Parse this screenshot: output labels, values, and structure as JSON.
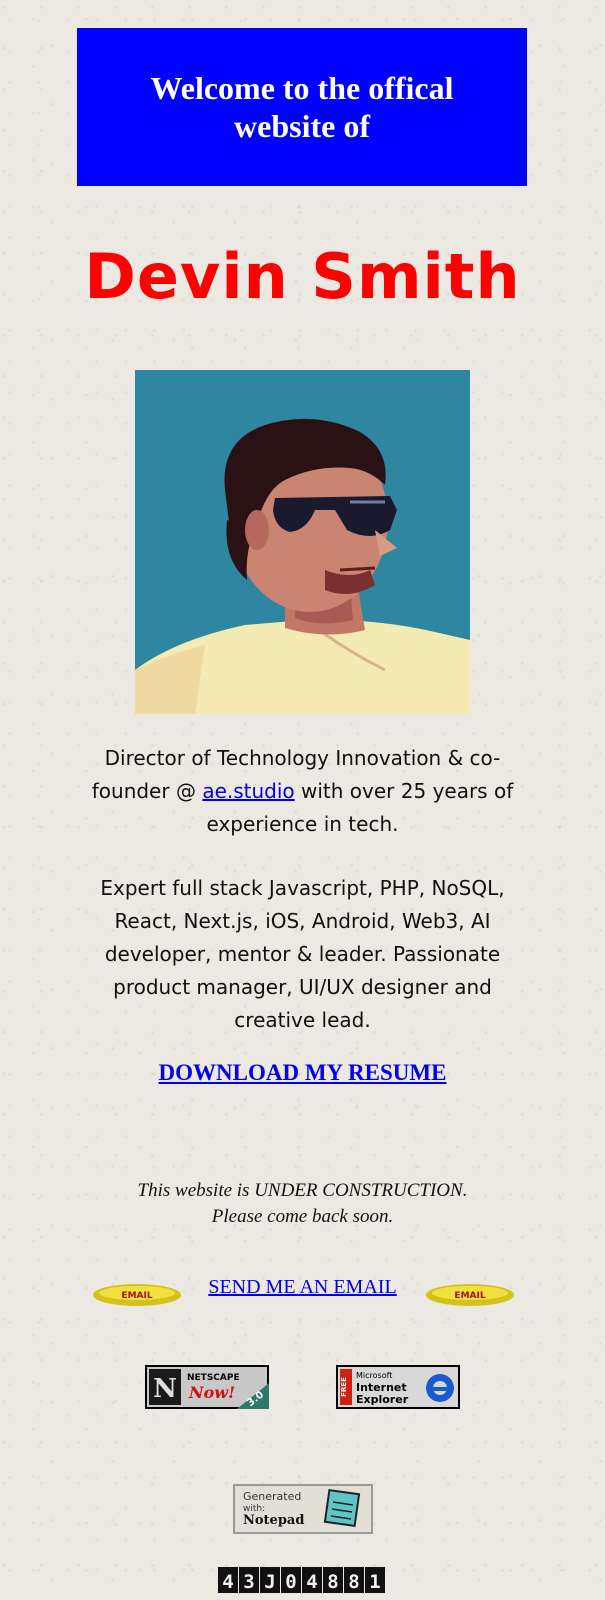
{
  "banner": {
    "text": "Welcome to the offical website of"
  },
  "name": "Devin Smith",
  "bio": {
    "part1_before": "Director of Technology Innovation & co-founder @ ",
    "link": "ae.studio",
    "part1_after": " with over 25 years of experience in tech.",
    "part2": "Expert full stack Javascript, PHP, NoSQL, React, Next.js, iOS, Android, Web3, AI developer, mentor & leader. Passionate product manager, UI/UX designer and creative lead."
  },
  "resume_link": "DOWNLOAD MY RESUME",
  "construction": {
    "line1": "This website is UNDER CONSTRUCTION.",
    "line2": "Please come back soon."
  },
  "email": {
    "link": "SEND ME AN EMAIL",
    "icon_label": "EMAIL"
  },
  "badges": {
    "netscape": {
      "line1": "NETSCAPE",
      "line2": "Now!",
      "version": "3.0"
    },
    "ie": {
      "free": "FREE",
      "line1": "Microsoft",
      "line2": "Internet",
      "line3": "Explorer"
    }
  },
  "notepad": {
    "line1": "Generated",
    "line2": "with:",
    "line3": "Notepad"
  },
  "counter": {
    "digits": [
      "4",
      "3",
      "J",
      "0",
      "4",
      "8",
      "8",
      "1"
    ]
  },
  "colors": {
    "banner": "#0000ff",
    "name": "#ff0000",
    "link": "#0000ee"
  }
}
